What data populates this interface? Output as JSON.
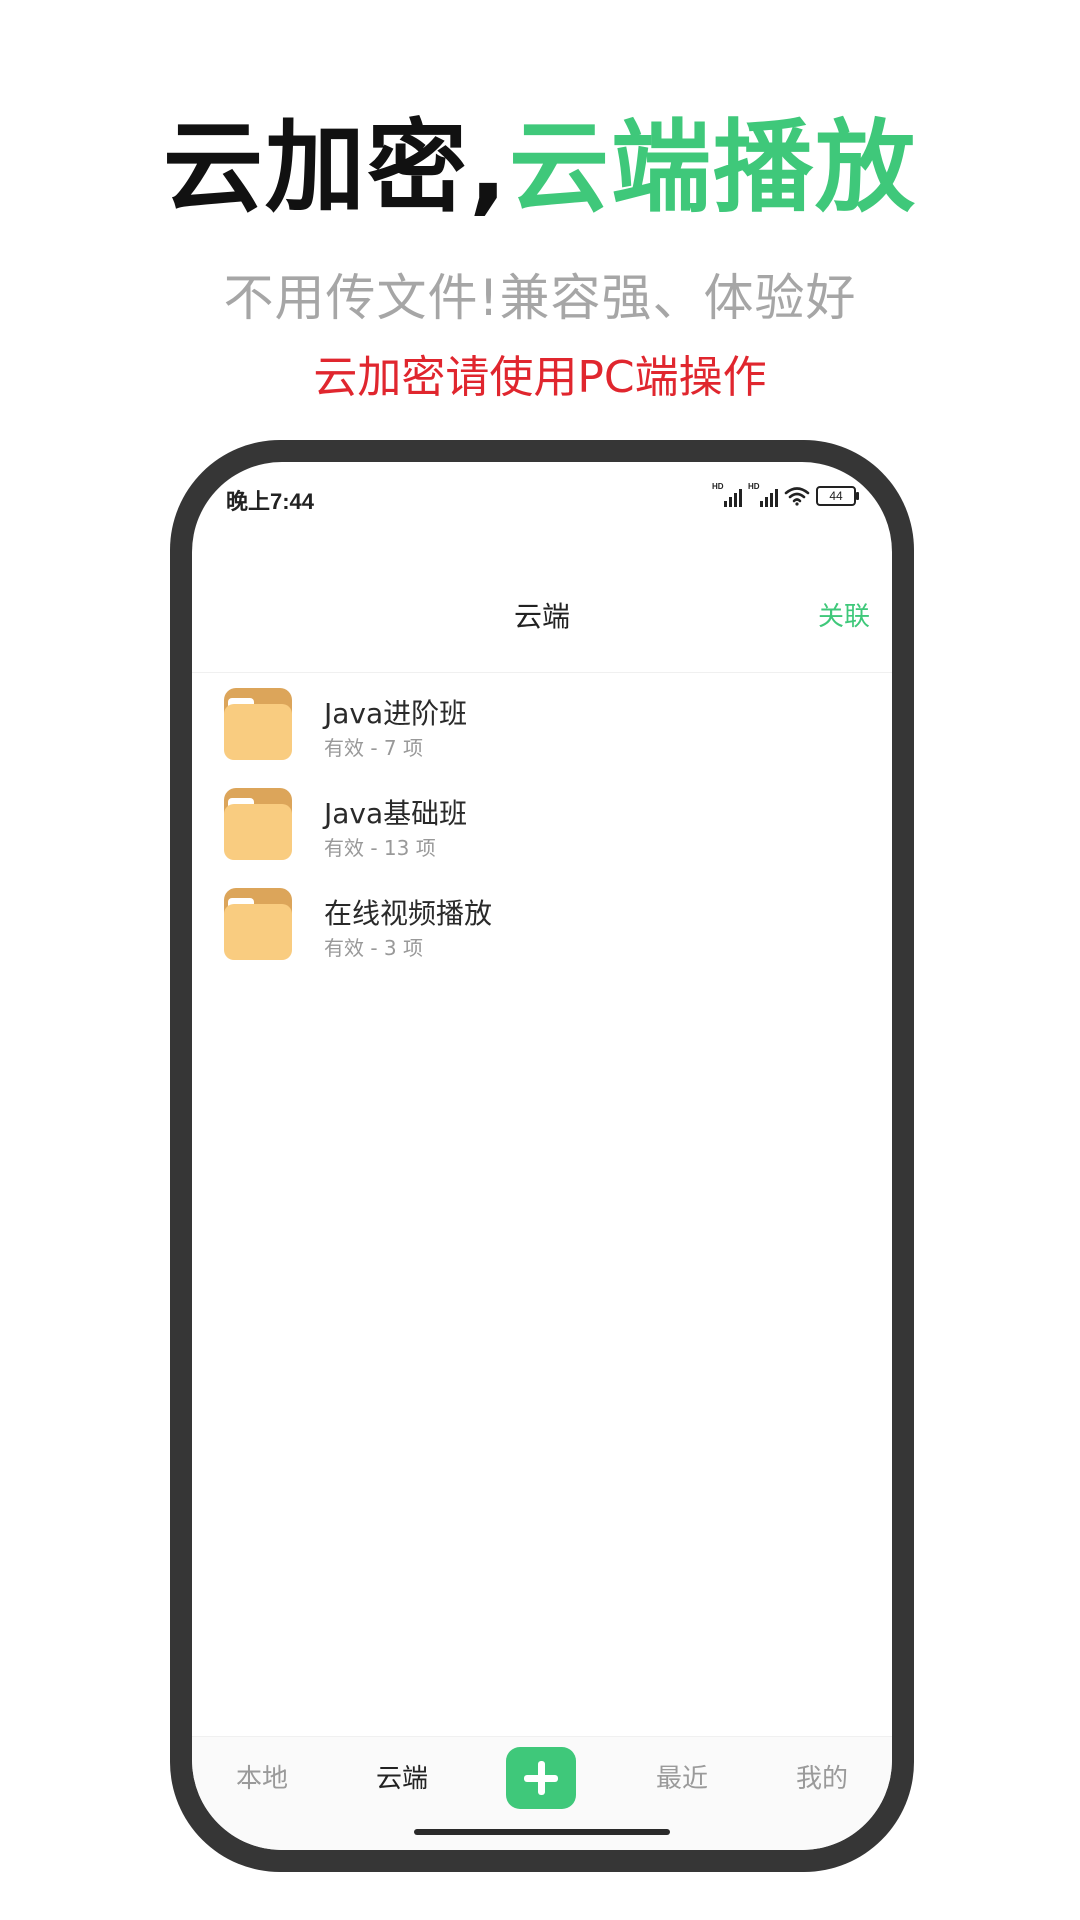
{
  "promo": {
    "headline_black": "云加密,",
    "headline_green": "云端播放",
    "subline": "不用传文件!兼容强、体验好",
    "notice": "云加密请使用PC端操作"
  },
  "status_bar": {
    "time": "晚上7:44",
    "signal_label": "HD",
    "battery": "44"
  },
  "nav": {
    "title": "云端",
    "action": "关联"
  },
  "files": [
    {
      "name": "Java进阶班",
      "meta": "有效 - 7 项",
      "icon": "folder-icon"
    },
    {
      "name": "Java基础班",
      "meta": "有效 - 13 项",
      "icon": "folder-icon"
    },
    {
      "name": "在线视频播放",
      "meta": "有效 - 3 项",
      "icon": "folder-icon"
    }
  ],
  "tabs": {
    "local": "本地",
    "cloud": "云端",
    "add_icon": "plus-icon",
    "recent": "最近",
    "mine": "我的"
  },
  "colors": {
    "accent": "#3fc87a",
    "notice": "#e0262e",
    "folder_front": "#f9cc80",
    "folder_back": "#dca55a",
    "phone_frame": "#363636"
  }
}
